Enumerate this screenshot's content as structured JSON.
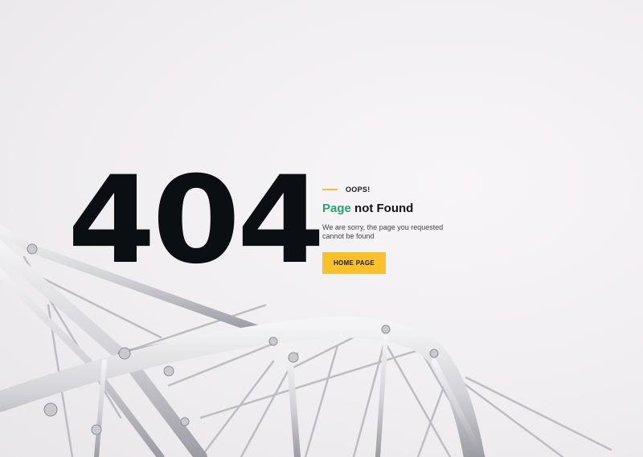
{
  "error": {
    "code": "404",
    "kicker": "OOPS!",
    "heading_accent": "Page",
    "heading_rest": "not Found",
    "message": "We are sorry, the page you requested cannot be found",
    "button_label": "HOME PAGE"
  },
  "colors": {
    "accent_green": "#2aa36c",
    "accent_yellow": "#fac12d",
    "code_text": "#0b0e13"
  }
}
